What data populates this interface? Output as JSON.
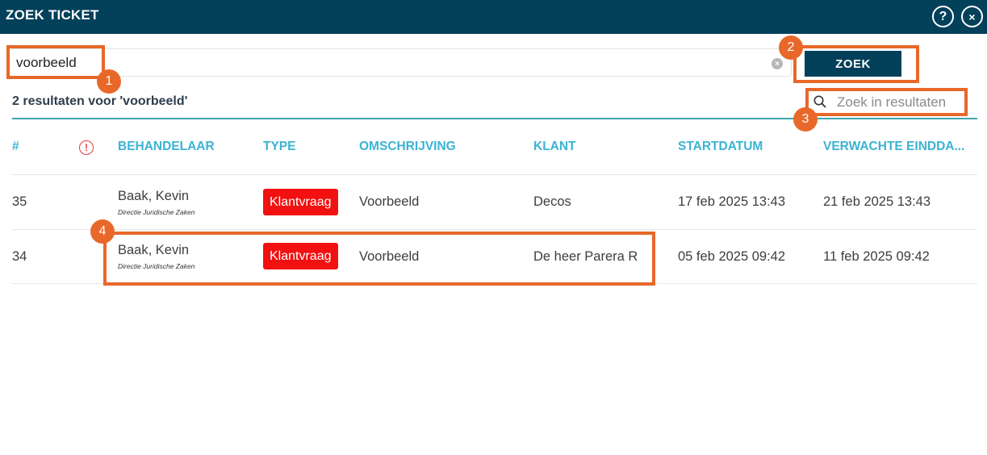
{
  "window": {
    "title": "ZOEK TICKET",
    "help_icon": "?",
    "close_icon": "×"
  },
  "search": {
    "value": "voorbeeld",
    "clear_icon": "×",
    "button_label": "ZOEK"
  },
  "results": {
    "summary": "2 resultaten voor 'voorbeeld'",
    "filter_placeholder": "Zoek in resultaten"
  },
  "table": {
    "headers": {
      "id": "#",
      "alert": "!",
      "handler": "BEHANDELAAR",
      "type": "TYPE",
      "description": "OMSCHRIJVING",
      "client": "KLANT",
      "start": "STARTDATUM",
      "due": "VERWACHTE EINDDA..."
    },
    "rows": [
      {
        "id": "35",
        "handler": "Baak, Kevin",
        "department": "Directie Juridische Zaken",
        "type": "Klantvraag",
        "description": "Voorbeeld",
        "client": "Decos",
        "start": "17 feb 2025 13:43",
        "due": "21 feb 2025 13:43"
      },
      {
        "id": "34",
        "handler": "Baak, Kevin",
        "department": "Directie Juridische Zaken",
        "type": "Klantvraag",
        "description": "Voorbeeld",
        "client": "De heer Parera R",
        "start": "05 feb 2025 09:42",
        "due": "11 feb 2025 09:42"
      }
    ]
  },
  "callouts": [
    "1",
    "2",
    "3",
    "4"
  ],
  "colors": {
    "header_bg": "#03405a",
    "accent_teal": "#3bb3d3",
    "badge_red": "#f21010",
    "callout_orange": "#e8682a"
  }
}
